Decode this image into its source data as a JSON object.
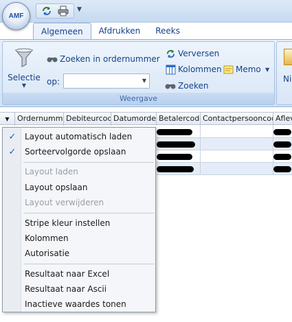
{
  "app": {
    "logo_text": "AMF"
  },
  "tabs": [
    {
      "label": "Algemeen",
      "active": true
    },
    {
      "label": "Afdrukken",
      "active": false
    },
    {
      "label": "Reeks",
      "active": false
    }
  ],
  "ribbon": {
    "group_label": "Weergave",
    "selectie_label": "Selectie",
    "zoeken_in_label": "Zoeken in ordernummer",
    "op_label": "op:",
    "op_value": "",
    "verversen_label": "Verversen",
    "kolommen_label": "Kolommen",
    "memo_label": "Memo",
    "zoeken_label": "Zoeken",
    "next_group_partial_label": "Ni"
  },
  "grid": {
    "columns": [
      "Ordernummer",
      "Debiteurcode",
      "Datumorder",
      "Betalercode",
      "Contactpersooncode",
      "Aflev"
    ]
  },
  "context_menu": {
    "items": [
      {
        "label": "Layout automatisch laden",
        "checked": true,
        "enabled": true
      },
      {
        "label": "Sorteervolgorde opslaan",
        "checked": true,
        "enabled": true
      },
      {
        "label": "Layout laden",
        "checked": false,
        "enabled": false
      },
      {
        "label": "Layout opslaan",
        "checked": false,
        "enabled": true
      },
      {
        "label": "Layout verwijderen",
        "checked": false,
        "enabled": false
      },
      {
        "label": "Stripe kleur instellen",
        "checked": false,
        "enabled": true
      },
      {
        "label": "Kolommen",
        "checked": false,
        "enabled": true
      },
      {
        "label": "Autorisatie",
        "checked": false,
        "enabled": true
      },
      {
        "label": "Resultaat naar Excel",
        "checked": false,
        "enabled": true
      },
      {
        "label": "Resultaat naar Ascii",
        "checked": false,
        "enabled": true
      },
      {
        "label": "Inactieve waardes tonen",
        "checked": false,
        "enabled": true
      }
    ]
  },
  "colors": {
    "accent": "#15428b",
    "check": "#1f5fb8",
    "stripe": "#e4ecf8"
  }
}
